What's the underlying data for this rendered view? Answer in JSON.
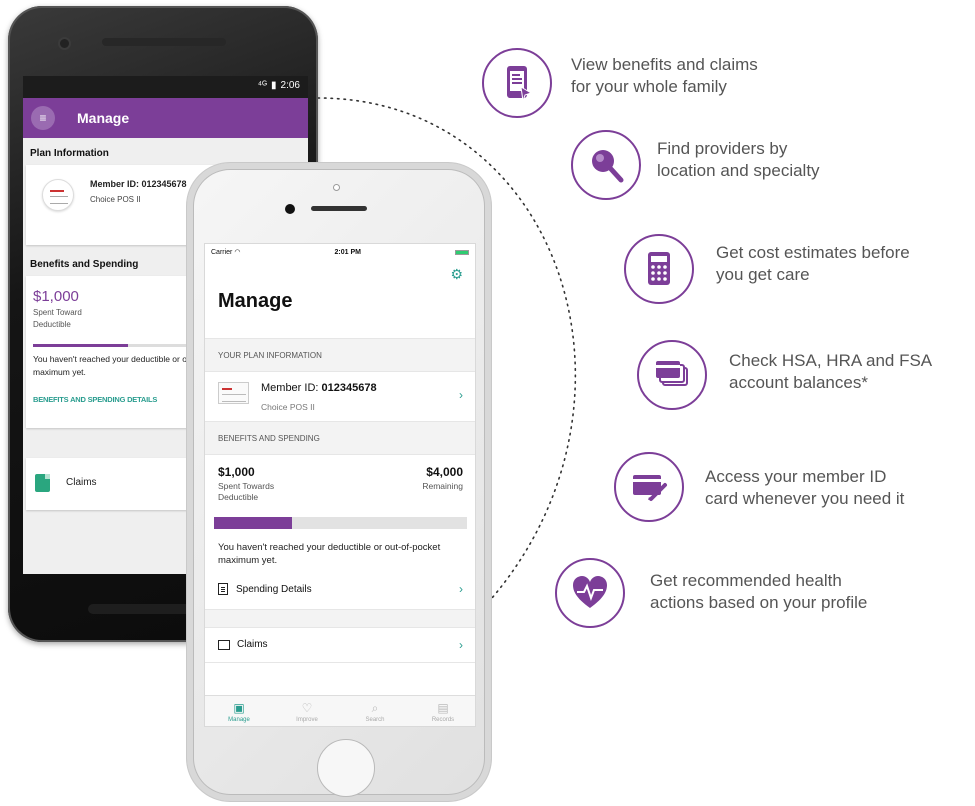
{
  "android": {
    "status_time": "2:06",
    "app_title": "Manage",
    "plan_section_title": "Plan Information",
    "member_id": "Member ID: 012345678",
    "plan_name": "Choice POS II",
    "benefits_section_title": "Benefits and Spending",
    "spent_amount": "$1,000",
    "spent_label": "Spent Toward Deductible",
    "progress_fraction": 0.35,
    "deductible_message": "You haven't reached your deductible or out-of-pocket maximum yet.",
    "details_link": "BENEFITS AND SPENDING DETAILS",
    "claims_label": "Claims"
  },
  "iphone": {
    "carrier": "Carrier",
    "time": "2:01 PM",
    "title": "Manage",
    "plan_section": "YOUR PLAN INFORMATION",
    "member_id_label": "Member ID: ",
    "member_id_value": "012345678",
    "plan_name": "Choice POS II",
    "benefits_section": "BENEFITS AND SPENDING",
    "spent_amount": "$1,000",
    "spent_label": "Spent Towards Deductible",
    "remaining_amount": "$4,000",
    "remaining_label": "Remaining",
    "progress_fraction": 0.31,
    "message": "You haven't reached your deductible or out-of-pocket maximum yet.",
    "spending_details": "Spending Details",
    "claims": "Claims",
    "tabs": [
      {
        "label": "Manage",
        "icon": "manage-icon",
        "active": true
      },
      {
        "label": "Improve",
        "icon": "heart-icon",
        "active": false
      },
      {
        "label": "Search",
        "icon": "search-icon",
        "active": false
      },
      {
        "label": "Records",
        "icon": "records-icon",
        "active": false
      }
    ]
  },
  "features": [
    {
      "icon": "phone-document-icon",
      "line1": "View benefits and claims",
      "line2": "for your whole family"
    },
    {
      "icon": "magnifier-icon",
      "line1": "Find providers by",
      "line2": "location and specialty"
    },
    {
      "icon": "calculator-icon",
      "line1": "Get cost estimates before",
      "line2": "you get care"
    },
    {
      "icon": "cards-icon",
      "line1": "Check HSA, HRA and FSA",
      "line2": "account balances*"
    },
    {
      "icon": "id-card-icon",
      "line1": "Access your member ID",
      "line2": "card whenever you need it"
    },
    {
      "icon": "heart-pulse-icon",
      "line1": "Get recommended health",
      "line2": "actions based on your profile"
    }
  ],
  "colors": {
    "brand_purple": "#7c3e98",
    "accent_teal": "#2a9d8f"
  }
}
